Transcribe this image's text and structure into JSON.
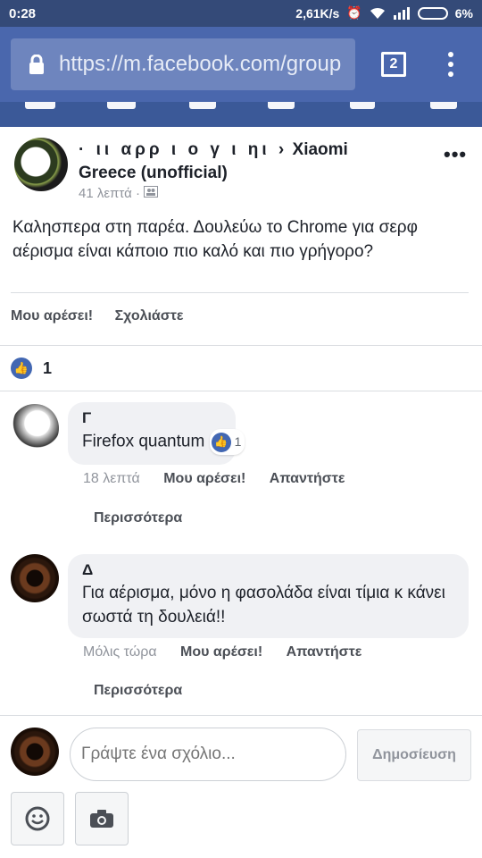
{
  "status": {
    "time": "0:28",
    "speed": "2,61K/s",
    "battery": "6%"
  },
  "browser": {
    "url": "https://m.facebook.com/group",
    "tab_count": "2"
  },
  "post": {
    "author_redacted": "· ιι  αρρ  ι  ο  γ  ι  ηι  ›",
    "group_name_line1": "Xiaomi",
    "group_name_line2": "Greece (unofficial)",
    "time": "41 λεπτά",
    "text": "Καλησπερα στη παρέα. Δουλεύω το Chrome για σερφ αέρισμα είναι κάποιο πιο καλό και πιο γρήγορο?",
    "like_label": "Μου αρέσει!",
    "comment_label": "Σχολιάστε",
    "like_count": "1"
  },
  "comments": [
    {
      "name": "Γ",
      "text": "Firefox quantum",
      "likes": "1",
      "time": "18 λεπτά",
      "like_label": "Μου αρέσει!",
      "reply_label": "Απαντήστε",
      "more_label": "Περισσότερα"
    },
    {
      "name": "Δ",
      "text": "Για αέρισμα, μόνο η φασολάδα είναι τίμια κ κάνει σωστά τη δουλειά!!",
      "time": "Μόλις τώρα",
      "like_label": "Μου αρέσει!",
      "reply_label": "Απαντήστε",
      "more_label": "Περισσότερα"
    }
  ],
  "composer": {
    "placeholder": "Γράψτε ένα σχόλιο...",
    "post_label": "Δημοσίευση"
  },
  "colors": {
    "status_bar": "#344a78",
    "toolbar": "#4a67ad",
    "nav": "#3b5998",
    "like_blue": "#4267b2"
  }
}
